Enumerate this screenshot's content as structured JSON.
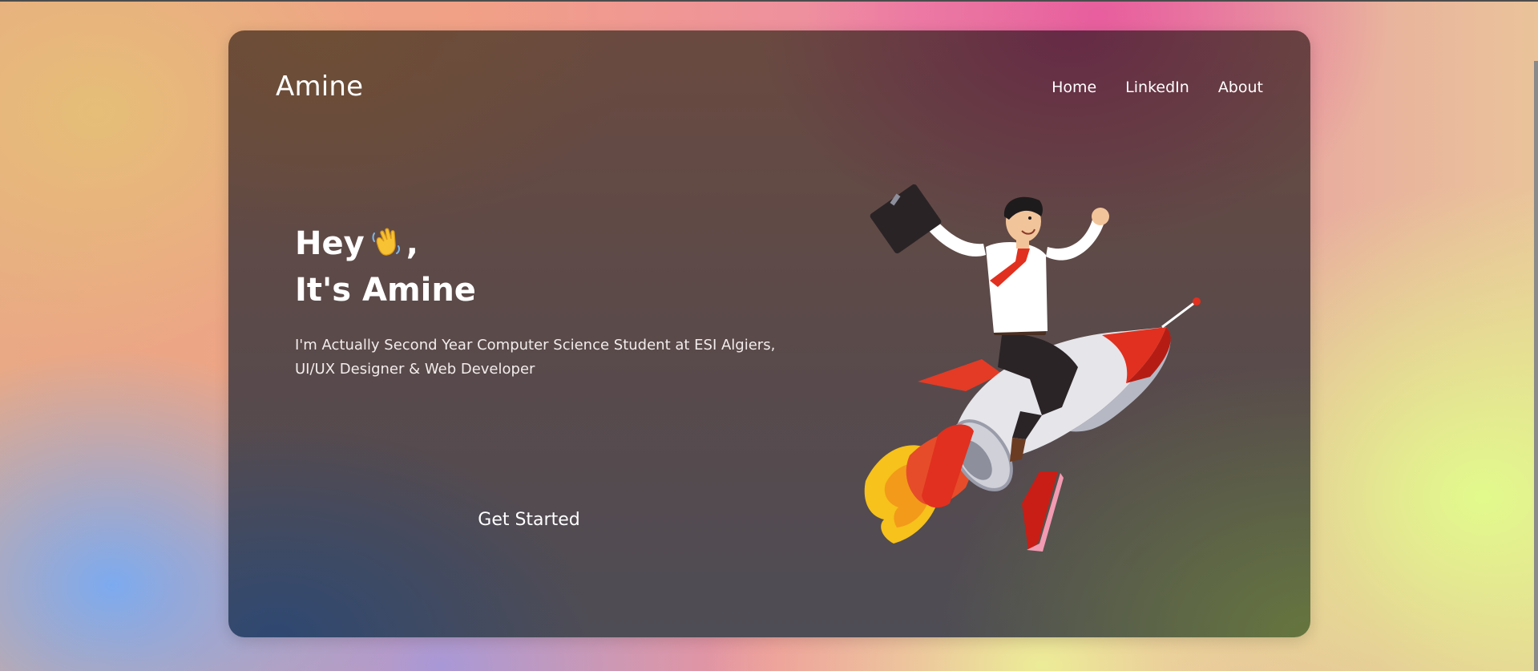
{
  "header": {
    "brand": "Amine",
    "nav": [
      "Home",
      "LinkedIn",
      "About"
    ]
  },
  "hero": {
    "greeting_text": "Hey",
    "greeting_suffix": ",",
    "title_line2": "It's Amine",
    "description_line1": "I'm Actually Second Year Computer Science Student at ESI Algiers,",
    "description_line2": "UI/UX Designer & Web Developer",
    "cta_label": "Get Started"
  },
  "icons": {
    "greeting_icon": "waving-hand-icon",
    "illustration": "businessman-riding-rocket-illustration"
  },
  "colors": {
    "text": "#ffffff",
    "card_tone": "#5a4a4a",
    "rocket_red": "#e1301f",
    "flame_yellow": "#f6c21b"
  }
}
